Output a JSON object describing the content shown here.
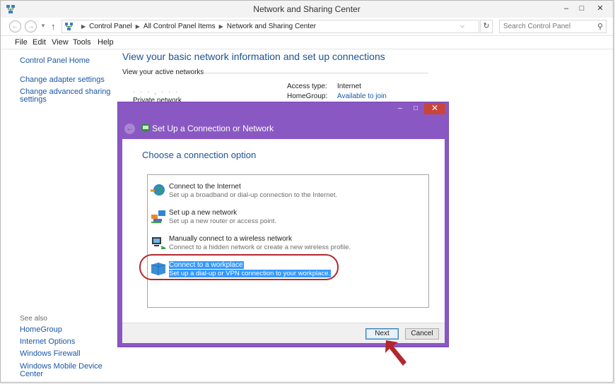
{
  "window": {
    "title": "Network and Sharing Center",
    "controls": [
      "–",
      "□",
      "✕"
    ]
  },
  "address": {
    "crumbs": [
      "Control Panel",
      "All Control Panel Items",
      "Network and Sharing Center"
    ],
    "search_placeholder": "Search Control Panel"
  },
  "menu": [
    "File",
    "Edit",
    "View",
    "Tools",
    "Help"
  ],
  "sidebar": {
    "items": [
      "Control Panel Home",
      "Change adapter settings",
      "Change advanced sharing",
      "settings"
    ],
    "see_also_label": "See also",
    "see_also": [
      "HomeGroup",
      "Internet Options",
      "Windows Firewall",
      "Windows Mobile Device Center"
    ]
  },
  "main": {
    "heading": "View your basic network information and set up connections",
    "active_networks_label": "View your active networks",
    "network_name": "· · · , · · ·",
    "network_type": "Private network",
    "access_type_label": "Access type:",
    "access_type_value": "Internet",
    "homegroup_label": "HomeGroup:",
    "homegroup_value": "Available to join"
  },
  "dialog": {
    "title": "Set Up a Connection or Network",
    "heading": "Choose a connection option",
    "options": [
      {
        "title": "Connect to the Internet",
        "desc": "Set up a broadband or dial-up connection to the Internet.",
        "selected": false
      },
      {
        "title": "Set up a new network",
        "desc": "Set up a new router or access point.",
        "selected": false
      },
      {
        "title": "Manually connect to a wireless network",
        "desc": "Connect to a hidden network or create a new wireless profile.",
        "selected": false
      },
      {
        "title": "Connect to a workplace",
        "desc": "Set up a dial-up or VPN connection to your workplace.",
        "selected": true
      }
    ],
    "next_label": "Next",
    "cancel_label": "Cancel"
  },
  "colors": {
    "dialog_frame": "#8a58c3",
    "selection": "#3399ff",
    "annotation": "#b4262e",
    "link": "#1b57a5"
  }
}
